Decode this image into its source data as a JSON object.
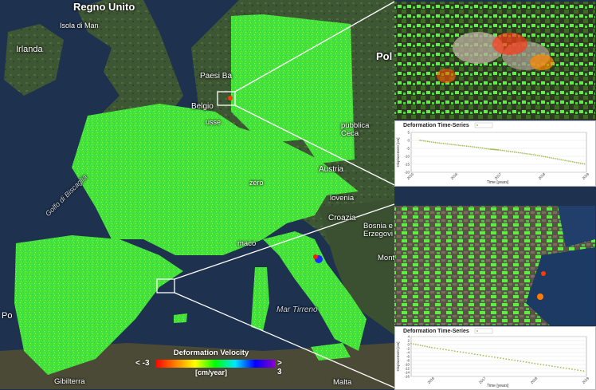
{
  "map_labels": {
    "regno_unito": "Regno Unito",
    "isola_di_man": "Isola di Man",
    "irlanda": "Irlanda",
    "paesi_bassi": "Paesi Ba",
    "belgio": "Belgio",
    "pol": "Pol",
    "repubblica_ceca": "pubblica\nCeca",
    "austria": "Austria",
    "slovenia": "lovenia",
    "croazia": "Croazia",
    "bosnia": "Bosnia e\nErzegovi",
    "monaco": "maco",
    "mar_tirreno": "Mar Tirreno",
    "golfo_di_biscaglia": "Golfo di Biscaglia",
    "po": "Po",
    "gibilterra": "Gibilterra",
    "malta": "Malta",
    "monte": "Mont",
    "lusse": "usse",
    "zero": "zero"
  },
  "legend": {
    "title": "Deformation Velocity",
    "min_label": "< -3",
    "max_label": "> 3",
    "unit": "[cm/year]",
    "colors": [
      "#ff0000",
      "#ff7f00",
      "#ffff00",
      "#00ff00",
      "#00e5ff",
      "#0000ff",
      "#8800cc"
    ]
  },
  "timeseries_panels": [
    {
      "title": "Deformation Time-Series",
      "xlabel": "Time [years]",
      "ylabel": "Displacement [cm]",
      "x_ticks": [
        "2015",
        "2016",
        "2017",
        "2018",
        "2019"
      ],
      "y_ticks": [
        "5",
        "0",
        "-5",
        "-10",
        "-15",
        "-20"
      ],
      "chart_data": {
        "type": "scatter",
        "x": [
          2015.2,
          2015.6,
          2016.0,
          2016.4,
          2016.8,
          2017.0,
          2017.4,
          2017.8,
          2018.2,
          2018.6,
          2019.0
        ],
        "y": [
          0,
          -1.5,
          -2.8,
          -4,
          -5.5,
          -6,
          -7.5,
          -9,
          -11,
          -13,
          -15
        ],
        "ylim": [
          -20,
          5
        ],
        "xlim": [
          2015,
          2019
        ]
      }
    },
    {
      "title": "Deformation Time-Series",
      "xlabel": "Time [years]",
      "ylabel": "Displacement [cm]",
      "x_ticks": [
        "2016",
        "2017",
        "2018",
        "2019"
      ],
      "y_ticks": [
        "4",
        "2",
        "0",
        "-2",
        "-4",
        "-6",
        "-8",
        "-10",
        "-12",
        "-14",
        "-16"
      ],
      "chart_data": {
        "type": "scatter",
        "x": [
          2015.6,
          2016.0,
          2016.5,
          2017.0,
          2017.5,
          2018.0,
          2018.5,
          2019.0
        ],
        "y": [
          0.5,
          -1.5,
          -3.5,
          -5.5,
          -7.5,
          -9.5,
          -11.5,
          -13.5
        ],
        "ylim": [
          -16,
          4
        ],
        "xlim": [
          2015.6,
          2019
        ]
      }
    }
  ],
  "colors": {
    "sea": "#1d2f4a",
    "land": "#3f5c34",
    "deformation_green": "#46e83a"
  }
}
